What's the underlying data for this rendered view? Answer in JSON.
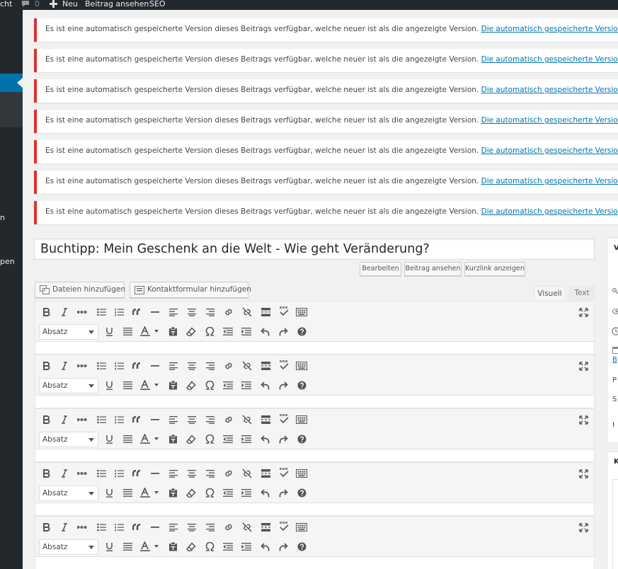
{
  "adminbar": {
    "site_fragment": "cht",
    "comments_count": "0",
    "new_label": "Neu",
    "view_post_label": "Beitrag ansehen",
    "seo_label": "SEO"
  },
  "sidebar": {
    "fragment_1": "n",
    "fragment_2": "pen"
  },
  "notices": {
    "message": "Es ist eine automatisch gespeicherte Version dieses Beitrags verfügbar, welche neuer ist als die angezeigte Version.",
    "link": "Die automatisch gespeicherte Version anzeigen"
  },
  "post": {
    "title": "Buchtipp: Mein Geschenk an die Welt - Wie geht Veränderung?",
    "edit_label": "Bearbeiten",
    "view_label": "Beitrag ansehen",
    "shortlink_label": "Kurzlink anzeigen"
  },
  "media": {
    "add_files_label": "Dateien hinzufügen",
    "add_form_label": "Kontaktformular hinzufügen"
  },
  "editor_tabs": {
    "visual": "Visuell",
    "text": "Text"
  },
  "editor": {
    "format_value": "Absatz"
  },
  "right_column": {
    "box1_title_fragment": "V",
    "box2_title_fragment": "K",
    "frag_b": "B",
    "frag_p": "P",
    "frag_s": "S",
    "frag_i": "I"
  },
  "colors": {
    "admin_dark": "#23282d",
    "admin_blue": "#0073aa",
    "notice_error": "#dc3232",
    "link": "#0073aa"
  }
}
